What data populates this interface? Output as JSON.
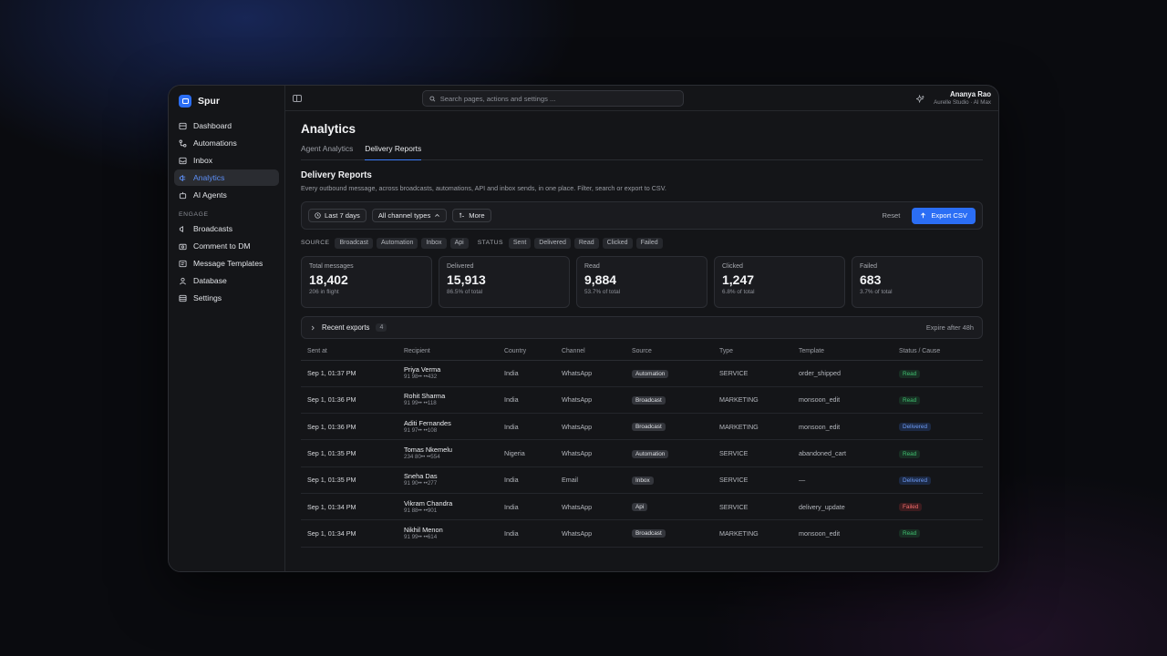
{
  "brand": {
    "name": "Spur"
  },
  "sidebar": {
    "items": [
      {
        "label": "Dashboard",
        "icon": "dashboard-icon"
      },
      {
        "label": "Automations",
        "icon": "automations-icon"
      },
      {
        "label": "Inbox",
        "icon": "inbox-icon"
      },
      {
        "label": "Analytics",
        "icon": "analytics-icon",
        "active": true
      },
      {
        "label": "AI Agents",
        "icon": "ai-agents-icon"
      }
    ],
    "section_label": "ENGAGE",
    "engage_items": [
      {
        "label": "Broadcasts",
        "icon": "broadcast-icon"
      },
      {
        "label": "Comment to DM",
        "icon": "comment-icon"
      },
      {
        "label": "Message Templates",
        "icon": "template-icon"
      },
      {
        "label": "Database",
        "icon": "database-icon"
      },
      {
        "label": "Settings",
        "icon": "settings-icon"
      }
    ]
  },
  "topbar": {
    "search_placeholder": "Search pages, actions and settings ...",
    "user_name": "Ananya Rao",
    "user_org": "Aurelle Studio · AI Max"
  },
  "page": {
    "title": "Analytics",
    "tabs": [
      {
        "label": "Agent Analytics"
      },
      {
        "label": "Delivery Reports",
        "active": true
      }
    ],
    "section_title": "Delivery Reports",
    "section_subtitle": "Every outbound message, across broadcasts, automations, API and inbox sends, in one place. Filter, search or export to CSV."
  },
  "filters": {
    "date_range": "Last 7 days",
    "channel": "All channel types",
    "more": "More",
    "reset": "Reset",
    "export": "Export CSV"
  },
  "chips": {
    "source_label": "SOURCE",
    "source": [
      "Broadcast",
      "Automation",
      "Inbox",
      "Api"
    ],
    "status_label": "STATUS",
    "status": [
      "Sent",
      "Delivered",
      "Read",
      "Clicked",
      "Failed"
    ]
  },
  "stats": [
    {
      "label": "Total messages",
      "value": "18,402",
      "sub": "206 in flight"
    },
    {
      "label": "Delivered",
      "value": "15,913",
      "sub": "86.5% of total"
    },
    {
      "label": "Read",
      "value": "9,884",
      "sub": "53.7% of total"
    },
    {
      "label": "Clicked",
      "value": "1,247",
      "sub": "6.8% of total"
    },
    {
      "label": "Failed",
      "value": "683",
      "sub": "3.7% of total"
    }
  ],
  "recent_exports": {
    "label": "Recent exports",
    "count": "4",
    "note": "Expire after 48h"
  },
  "table": {
    "headers": [
      "Sent at",
      "Recipient",
      "Country",
      "Channel",
      "Source",
      "Type",
      "Template",
      "Status / Cause"
    ],
    "rows": [
      {
        "sent": "Sep 1, 01:37 PM",
        "name": "Priya Verma",
        "phone": "91 98•• ••432",
        "country": "India",
        "channel": "WhatsApp",
        "source": "Automation",
        "type": "SERVICE",
        "template": "order_shipped",
        "status": "Read"
      },
      {
        "sent": "Sep 1, 01:36 PM",
        "name": "Rohit Sharma",
        "phone": "91 99•• ••118",
        "country": "India",
        "channel": "WhatsApp",
        "source": "Broadcast",
        "type": "MARKETING",
        "template": "monsoon_edit",
        "status": "Read"
      },
      {
        "sent": "Sep 1, 01:36 PM",
        "name": "Aditi Fernandes",
        "phone": "91 97•• ••108",
        "country": "India",
        "channel": "WhatsApp",
        "source": "Broadcast",
        "type": "MARKETING",
        "template": "monsoon_edit",
        "status": "Delivered"
      },
      {
        "sent": "Sep 1, 01:35 PM",
        "name": "Tomas Nkemelu",
        "phone": "234 80•• ••554",
        "country": "Nigeria",
        "channel": "WhatsApp",
        "source": "Automation",
        "type": "SERVICE",
        "template": "abandoned_cart",
        "status": "Read"
      },
      {
        "sent": "Sep 1, 01:35 PM",
        "name": "Sneha Das",
        "phone": "91 90•• ••277",
        "country": "India",
        "channel": "Email",
        "source": "Inbox",
        "type": "SERVICE",
        "template": "—",
        "status": "Delivered"
      },
      {
        "sent": "Sep 1, 01:34 PM",
        "name": "Vikram Chandra",
        "phone": "91 88•• ••901",
        "country": "India",
        "channel": "WhatsApp",
        "source": "Api",
        "type": "SERVICE",
        "template": "delivery_update",
        "status": "Failed"
      },
      {
        "sent": "Sep 1, 01:34 PM",
        "name": "Nikhil Menon",
        "phone": "91 99•• ••614",
        "country": "India",
        "channel": "WhatsApp",
        "source": "Broadcast",
        "type": "MARKETING",
        "template": "monsoon_edit",
        "status": "Read"
      }
    ]
  }
}
